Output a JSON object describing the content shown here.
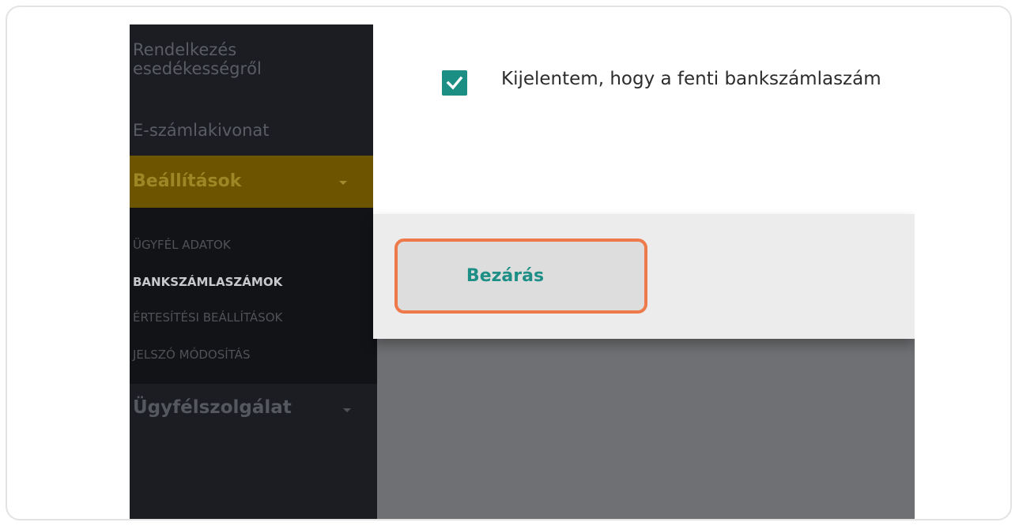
{
  "sidebar": {
    "items": [
      {
        "label": "Rendelkezés\nesedékességről"
      },
      {
        "label": "E-számlakivonat"
      }
    ],
    "active_section": {
      "label": "Beállítások"
    },
    "submenu": [
      {
        "label": "ÜGYFÉL ADATOK"
      },
      {
        "label": "BANKSZÁMLASZÁMOK",
        "active": true
      },
      {
        "label": "ÉRTESÍTÉSI BEÁLLÍTÁSOK"
      },
      {
        "label": "JELSZÓ MÓDOSÍTÁS"
      }
    ],
    "customer_service": {
      "label": "Ügyfélszolgálat"
    }
  },
  "dialog": {
    "checkbox_checked": true,
    "consent_text": "Kijelentem, hogy a fenti bankszámlaszám",
    "close_button": "Bezárás"
  },
  "colors": {
    "accent_teal": "#1c8f84",
    "highlight_orange": "#ee7a4b",
    "active_gold": "#6c5400"
  }
}
